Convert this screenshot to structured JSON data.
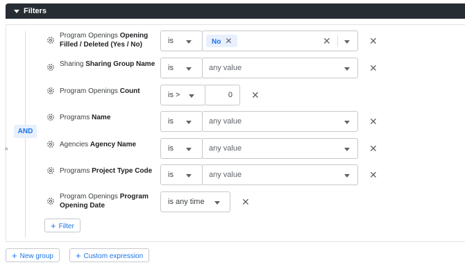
{
  "header": {
    "title": "Filters"
  },
  "group": {
    "operator": "AND"
  },
  "filters": [
    {
      "prefix": "Program Openings",
      "field": "Opening Filled / Deleted (Yes / No)",
      "operator": "is",
      "chip": "No"
    },
    {
      "prefix": "Sharing",
      "field": "Sharing Group Name",
      "operator": "is",
      "value_placeholder": "any value"
    },
    {
      "prefix": "Program Openings",
      "field": "Count",
      "operator": "is >",
      "value": "0"
    },
    {
      "prefix": "Programs",
      "field": "Name",
      "operator": "is",
      "value_placeholder": "any value"
    },
    {
      "prefix": "Agencies",
      "field": "Agency Name",
      "operator": "is",
      "value_placeholder": "any value"
    },
    {
      "prefix": "Programs",
      "field": "Project Type Code",
      "operator": "is",
      "value_placeholder": "any value"
    },
    {
      "prefix": "Program Openings",
      "field": "Program Opening Date",
      "operator": "is any time"
    }
  ],
  "buttons": {
    "add_filter": "Filter",
    "new_group": "New group",
    "custom_expression": "Custom expression"
  },
  "icons": {
    "remove": "close-icon",
    "settings": "gear-icon",
    "dropdown": "triangle-down-icon",
    "add": "plus-icon",
    "collapse": "chevron-up-icon"
  },
  "colors": {
    "header_bg": "#262d33",
    "accent": "#1a73e8",
    "chip_bg": "#e8f0fe"
  }
}
